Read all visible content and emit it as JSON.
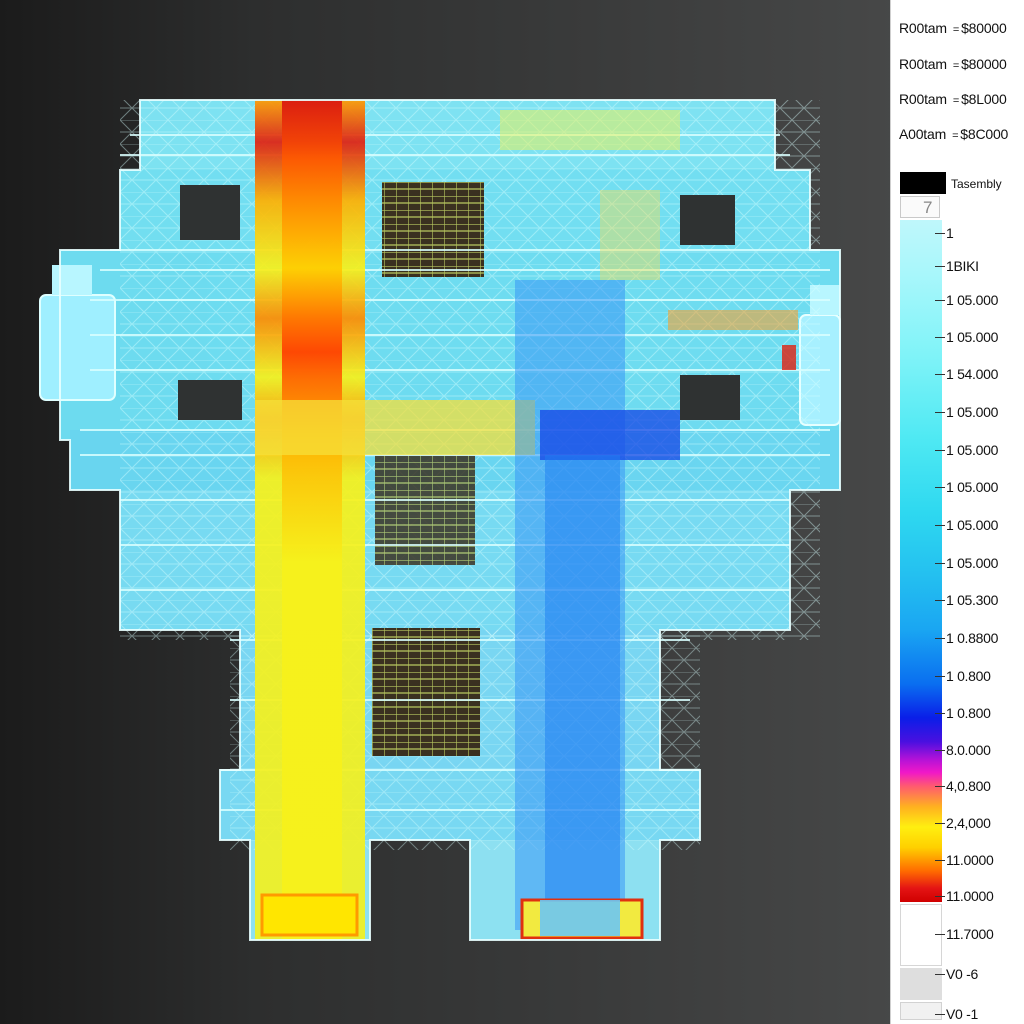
{
  "results": [
    {
      "label": "R00tam",
      "value": "$80000"
    },
    {
      "label": "R00tam",
      "value": "$80000"
    },
    {
      "label": "R00tam",
      "value": "$8L000"
    },
    {
      "label": "A00tam",
      "value": "$8C000"
    }
  ],
  "legend": {
    "title": "Tasembly",
    "top_mark": "7",
    "labels": [
      "1",
      "1BIKI",
      "1 05.000",
      "1 05.000",
      "1 54.000",
      "1 05.000",
      "1 05.000",
      "1 05.000",
      "1 05.000",
      "1 05.000",
      "1 05.300",
      "1 0.8800",
      "1 0.800",
      "1 0.800",
      "8.0.000",
      "4,0.800",
      "2,4,000",
      "11.0000",
      "11.0000",
      "11.7000",
      "V0 -6",
      "V0 -1"
    ],
    "colors": {
      "top": "#bff7fb",
      "cyan": "#2ed8f0",
      "blue": "#0a1ee8",
      "magenta": "#f018c8",
      "yellow": "#ffef10",
      "red": "#d00000"
    }
  },
  "model": {
    "base_color": "#6fe0f4",
    "hot_column_colors": [
      "#f7f11a",
      "#ff9a00",
      "#e02010"
    ],
    "cool_column_color": "#1e7ef2"
  }
}
